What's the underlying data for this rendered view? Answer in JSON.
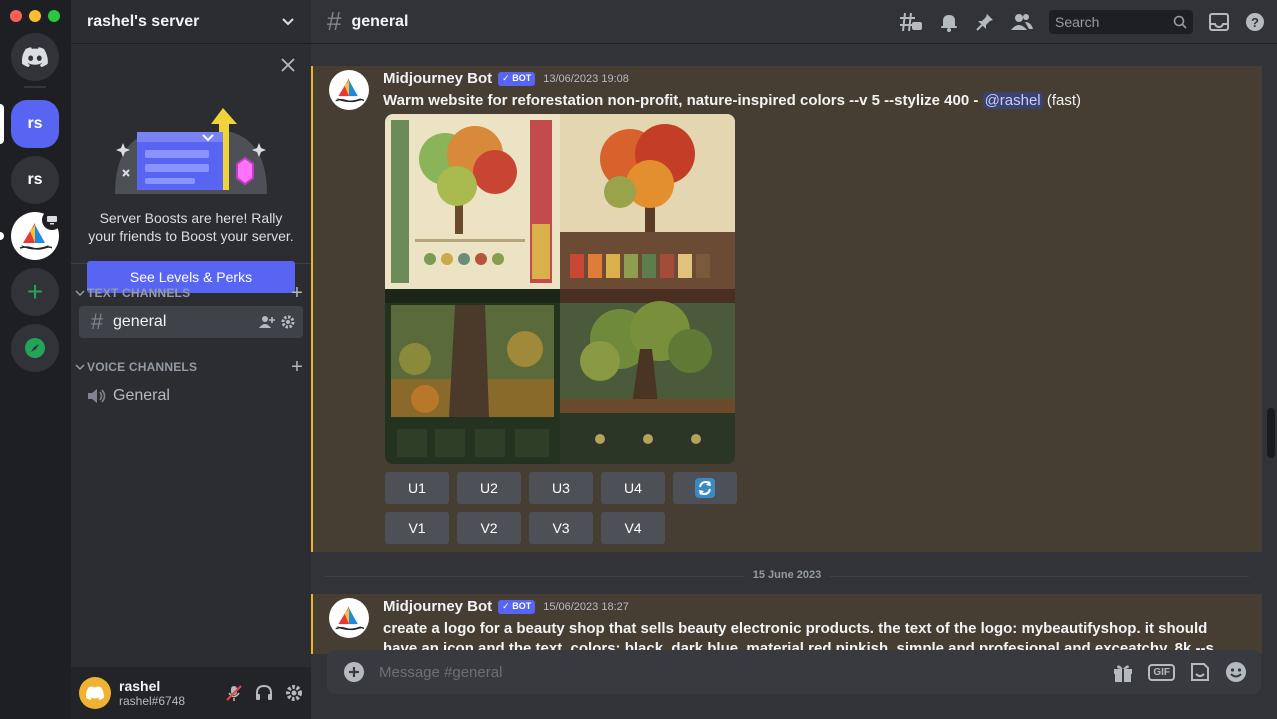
{
  "servers": {
    "rs1": "rs",
    "rs2": "rs",
    "add": "+"
  },
  "server_name": "rashel's server",
  "boost": {
    "text": "Server Boosts are here! Rally your friends to Boost your server.",
    "button": "See Levels & Perks"
  },
  "categories": {
    "text": "TEXT CHANNELS",
    "voice": "VOICE CHANNELS"
  },
  "channels": {
    "general_text": "general",
    "general_voice": "General"
  },
  "user": {
    "name": "rashel",
    "tag": "rashel#6748"
  },
  "channel_header": {
    "title": "general",
    "search_placeholder": "Search"
  },
  "messages": [
    {
      "author": "Midjourney Bot",
      "badge": "✓ BOT",
      "timestamp": "13/06/2023 19:08",
      "prompt": "Warm website for reforestation non-profit, nature-inspired colors --v 5 --stylize 400",
      "separator": " - ",
      "mention": "@rashel",
      "mode": "(fast)",
      "buttons_row1": [
        "U1",
        "U2",
        "U3",
        "U4"
      ],
      "buttons_row2": [
        "V1",
        "V2",
        "V3",
        "V4"
      ]
    },
    {
      "author": "Midjourney Bot",
      "badge": "✓ BOT",
      "timestamp": "15/06/2023 18:27",
      "prompt": "create a logo for a beauty shop that sells beauty electronic products. the text of the logo: mybeautifyshop. it should have an icon and the text, colors: black, dark blue, material red pinkish, simple and profesional and exceatchy, 8k --s"
    }
  ],
  "date_divider": "15 June 2023",
  "composer": {
    "placeholder": "Message #general"
  },
  "colors": {
    "accent": "#5865f2",
    "highlight_bg": "#463e33",
    "highlight_border": "#f0b232",
    "online": "#23a559"
  }
}
